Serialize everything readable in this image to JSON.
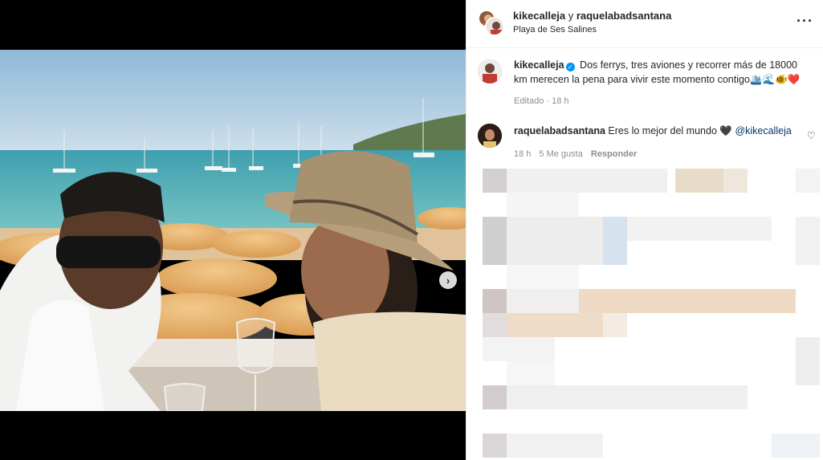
{
  "post": {
    "header": {
      "user1": "kikecalleja",
      "joiner": "y",
      "user2": "raquelabadsantana",
      "location": "Playa de Ses Salines",
      "more_icon": "more-horizontal-icon"
    },
    "caption": {
      "username": "kikecalleja",
      "verified": true,
      "text": "Dos ferrys, tres aviones y recorrer más de 18000 km merecen la pena para vivir este momento contigo🛳️🌊🐠❤️",
      "edited": "Editado",
      "sep": "·",
      "time": "18 h"
    },
    "comment": {
      "username": "raquelabadsantana",
      "text": "Eres lo mejor del mundo 🖤",
      "mention": "@kikecalleja",
      "time": "18 h",
      "likes": "5 Me gusta",
      "reply": "Responder"
    },
    "carousel": {
      "slide_count": 2,
      "active_index": 0,
      "next_icon": "chevron-right-icon"
    }
  },
  "colors": {
    "accent": "#0095f6",
    "muted": "#8e8e8e",
    "text": "#262626",
    "mention": "#00376b"
  }
}
